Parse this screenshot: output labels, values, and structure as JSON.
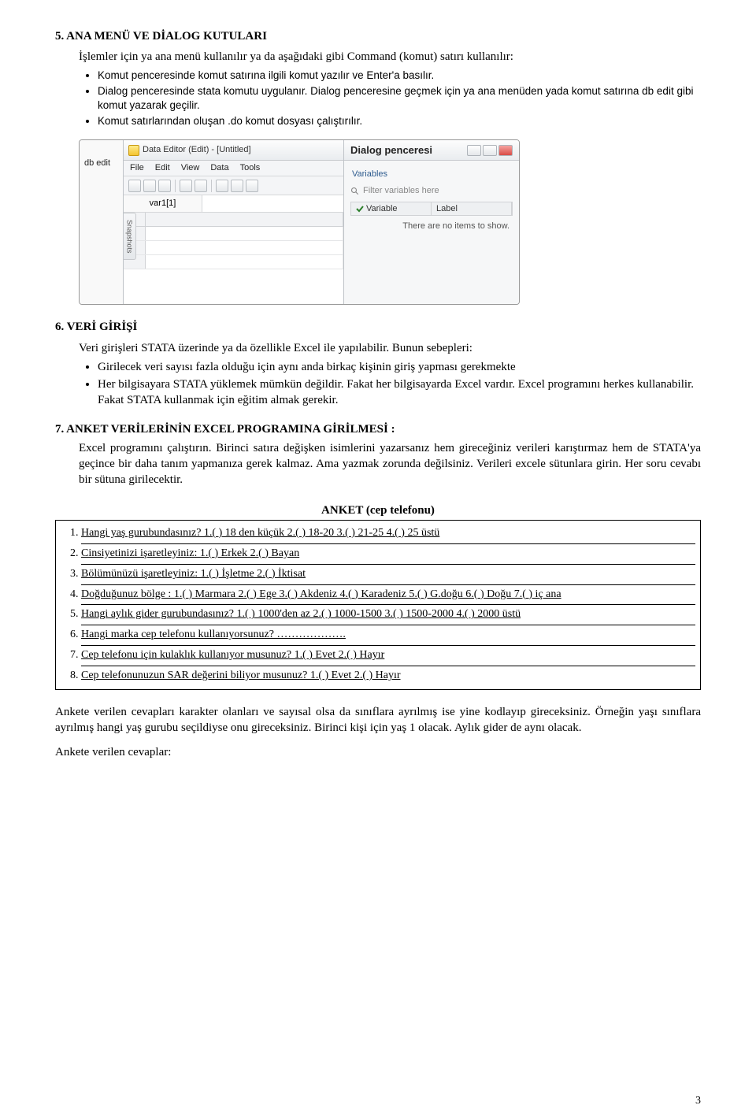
{
  "sec5": {
    "heading": "5.   ANA MENÜ VE DİALOG KUTULARI",
    "intro": "İşlemler için ya ana menü kullanılır ya da aşağıdaki gibi Command (komut) satırı kullanılır:",
    "b1": "Komut penceresinde komut satırına ilgili komut yazılır ve Enter'a basılır.",
    "b2": "Dialog penceresinde stata komutu uygulanır. Dialog penceresine geçmek için ya ana menüden yada komut satırına db edit gibi komut yazarak geçilir.",
    "b3": "Komut satırlarından oluşan .do komut dosyası çalıştırılır."
  },
  "shot": {
    "cmd": "db edit",
    "title": "Data Editor (Edit) - [Untitled]",
    "m_file": "File",
    "m_edit": "Edit",
    "m_view": "View",
    "m_data": "Data",
    "m_tools": "Tools",
    "cell": "var1[1]",
    "snap": "Snapshots",
    "dlg": "Dialog penceresi",
    "vars": "Variables",
    "filter_ph": "Filter variables here",
    "col1": "Variable",
    "col2": "Label",
    "noitems": "There are no items to show."
  },
  "sec6": {
    "heading": "6.   VERİ GİRİŞİ",
    "intro": "Veri girişleri STATA üzerinde ya da özellikle Excel ile yapılabilir. Bunun sebepleri:",
    "b1": "Girilecek veri sayısı fazla olduğu için aynı anda birkaç kişinin giriş yapması gerekmekte",
    "b2": "Her bilgisayara STATA yüklemek mümkün değildir. Fakat her bilgisayarda Excel vardır. Excel programını herkes kullanabilir. Fakat STATA kullanmak için eğitim almak gerekir."
  },
  "sec7": {
    "heading": "7.   ANKET VERİLERİNİN EXCEL PROGRAMINA GİRİLMESİ :",
    "para": "Excel programını çalıştırın. Birinci satıra değişken isimlerini yazarsanız hem gireceğiniz verileri karıştırmaz hem de STATA'ya geçince bir daha tanım yapmanıza gerek kalmaz. Ama yazmak zorunda değilsiniz. Verileri excele sütunlara girin. Her soru cevabı bir sütuna girilecektir."
  },
  "anket": {
    "title": "ANKET  (cep telefonu)",
    "q1": "Hangi yaş gurubundasınız?   1.( ) 18 den küçük   2.( ) 18-20      3.( ) 21-25  4.( ) 25 üstü",
    "q2": "Cinsiyetinizi işaretleyiniz:      1.( ) Erkek   2.( ) Bayan",
    "q3": "Bölümünüzü işaretleyiniz:    1.( ) İşletme   2.( ) İktisat",
    "q4": "Doğduğunuz bölge : 1.( ) Marmara   2.( ) Ege   3.( ) Akdeniz   4.( ) Karadeniz   5.( ) G.doğu   6.( ) Doğu  7.( ) iç ana",
    "q5": "Hangi aylık gider gurubundasınız?  1.( ) 1000'den az   2.( ) 1000-1500  3.( ) 1500-2000 4.( ) 2000 üstü",
    "q6": "Hangi marka cep telefonu kullanıyorsunuz? ……………….",
    "q7": "Cep telefonu için kulaklık kullanıyor musunuz?       1.( ) Evet 2.( ) Hayır",
    "q8": "Cep telefonunuzun SAR değerini biliyor musunuz?  1.( ) Evet  2.( ) Hayır"
  },
  "after": {
    "p1": "Ankete verilen cevapları karakter olanları ve sayısal olsa da sınıflara ayrılmış ise yine kodlayıp gireceksiniz. Örneğin yaşı sınıflara ayrılmış hangi yaş gurubu seçildiyse onu gireceksiniz. Birinci kişi için yaş 1 olacak. Aylık gider de aynı olacak.",
    "p2": "Ankete verilen cevaplar:"
  },
  "page": "3"
}
